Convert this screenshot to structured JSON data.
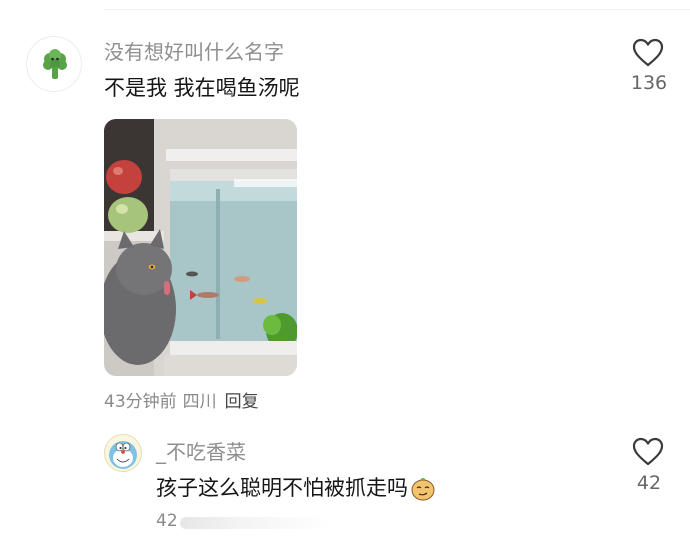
{
  "comments": [
    {
      "username": "没有想好叫什么名字",
      "text": "不是我 我在喝鱼汤呢",
      "likes": "136",
      "time": "43分钟前",
      "location": "四川",
      "reply_label": "回复",
      "avatar_icon": "broccoli-icon",
      "image_icon": "cat-fish-tank-photo"
    },
    {
      "username": "_不吃香菜",
      "text": "孩子这么聪明不怕被抓走吗",
      "likes": "42",
      "time_partial": "42",
      "avatar_icon": "doraemon-avatar-icon",
      "emoji_icon": "smirk-emoji-icon"
    }
  ],
  "colors": {
    "username": "#8f8f8f",
    "text": "#161616",
    "meta": "#8a8a8a",
    "like_outline": "#3a3a3a",
    "broccoli": "#5aa24a"
  }
}
